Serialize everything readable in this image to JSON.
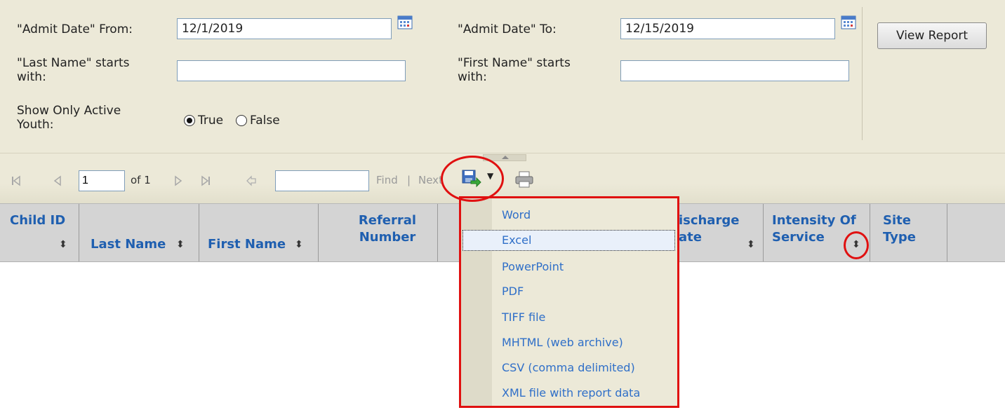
{
  "params": {
    "admit_from_label": "\"Admit Date\" From:",
    "admit_from_value": "12/1/2019",
    "admit_to_label": "\"Admit Date\" To:",
    "admit_to_value": "12/15/2019",
    "last_name_label": "\"Last Name\" starts with:",
    "last_name_value": "",
    "first_name_label": "\"First Name\" starts with:",
    "first_name_value": "",
    "active_label": "Show Only Active Youth:",
    "true_label": "True",
    "false_label": "False",
    "active_selected": "True",
    "view_report": "View Report"
  },
  "toolbar": {
    "page_value": "1",
    "of_pages": "of 1",
    "find_value": "",
    "find_label": "Find",
    "separator": "|",
    "next_label": "Next"
  },
  "columns": [
    {
      "label": "Child ID"
    },
    {
      "label": "Last Name"
    },
    {
      "label": "First Name"
    },
    {
      "label": "Referral Number"
    },
    {
      "label": ""
    },
    {
      "label": "Discharge Date"
    },
    {
      "label": "Intensity Of Service"
    },
    {
      "label": "Site Type"
    }
  ],
  "export_menu": {
    "items": [
      "Word",
      "Excel",
      "PowerPoint",
      "PDF",
      "TIFF file",
      "MHTML (web archive)",
      "CSV (comma delimited)",
      "XML file with report data"
    ],
    "highlighted": "Excel"
  },
  "colors": {
    "annotation": "#e01010",
    "link": "#2f6fc8",
    "header_text": "#1f5fb0"
  }
}
